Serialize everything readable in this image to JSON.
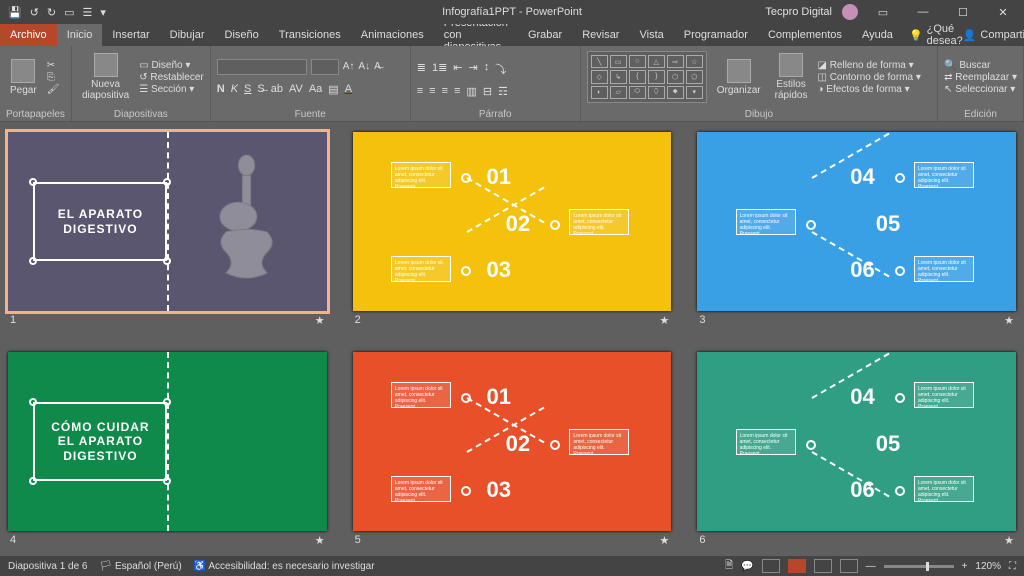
{
  "titlebar": {
    "title": "Infografía1PPT - PowerPoint",
    "user": "Tecpro Digital"
  },
  "menu": {
    "file": "Archivo",
    "tabs": [
      "Inicio",
      "Insertar",
      "Dibujar",
      "Diseño",
      "Transiciones",
      "Animaciones",
      "Presentación con diapositivas",
      "Grabar",
      "Revisar",
      "Vista",
      "Programador",
      "Complementos",
      "Ayuda"
    ],
    "tell": "¿Qué desea?",
    "share": "Compartir"
  },
  "ribbon": {
    "clipboard": {
      "paste": "Pegar",
      "label": "Portapapeles"
    },
    "slides": {
      "new": "Nueva\ndiapositiva",
      "layout": "Diseño",
      "reset": "Restablecer",
      "section": "Sección",
      "label": "Diapositivas"
    },
    "font": {
      "label": "Fuente"
    },
    "para": {
      "label": "Párrafo"
    },
    "draw": {
      "arrange": "Organizar",
      "styles": "Estilos\nrápidos",
      "fill": "Relleno de forma",
      "outline": "Contorno de forma",
      "effects": "Efectos de forma",
      "label": "Dibujo"
    },
    "edit": {
      "find": "Buscar",
      "replace": "Reemplazar",
      "select": "Seleccionar",
      "label": "Edición"
    }
  },
  "slides": [
    {
      "num": "1",
      "bg": "s-purple",
      "title": "EL APARATO\nDIGESTIVO",
      "selected": true
    },
    {
      "num": "2",
      "bg": "s-yellow",
      "nums": [
        "01",
        "02",
        "03"
      ]
    },
    {
      "num": "3",
      "bg": "s-blue",
      "nums": [
        "04",
        "05",
        "06"
      ]
    },
    {
      "num": "4",
      "bg": "s-green",
      "title": "CÓMO CUIDAR EL\nAPARATO\nDIGESTIVO"
    },
    {
      "num": "5",
      "bg": "s-orange",
      "nums": [
        "01",
        "02",
        "03"
      ]
    },
    {
      "num": "6",
      "bg": "s-teal",
      "nums": [
        "04",
        "05",
        "06"
      ]
    }
  ],
  "lorem": "Lorem ipsum dolor sit amet, consectetur adipiscing elit. Praesent",
  "status": {
    "slide": "Diapositiva 1 de 6",
    "lang": "Español (Perú)",
    "access": "Accesibilidad: es necesario investigar",
    "zoom": "120%"
  }
}
